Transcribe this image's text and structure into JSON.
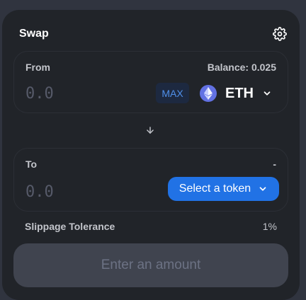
{
  "header": {
    "title": "Swap",
    "settings_icon": "gear-icon"
  },
  "from": {
    "label": "From",
    "balance": "Balance: 0.025",
    "amount_placeholder": "0.0",
    "max_label": "MAX",
    "token_symbol": "ETH",
    "token_icon": "ethereum-icon"
  },
  "switch": {
    "icon": "arrow-down-icon"
  },
  "to": {
    "label": "To",
    "balance": "-",
    "amount_placeholder": "0.0",
    "select_label": "Select a token"
  },
  "slippage": {
    "label": "Slippage Tolerance",
    "value": "1%"
  },
  "action": {
    "label": "Enter an amount"
  },
  "colors": {
    "background": "#30343f",
    "card": "#212429",
    "accent": "#2172e5",
    "max_text": "#5090ea",
    "disabled_button": "#40444f"
  }
}
